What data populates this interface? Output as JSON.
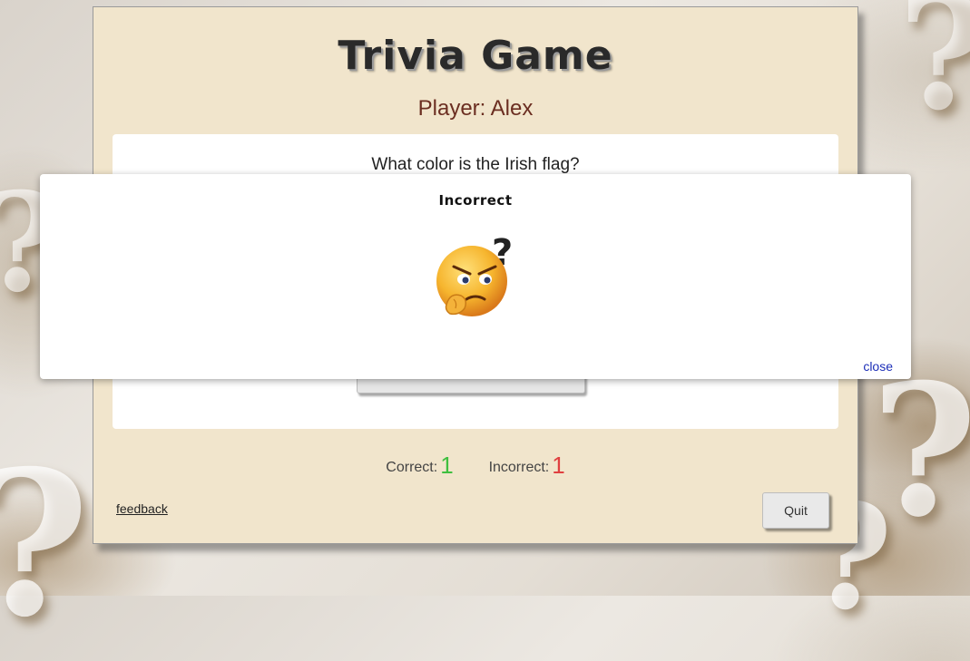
{
  "game": {
    "title": "Trivia Game",
    "player_label": "Player: Alex"
  },
  "question": {
    "text": "What color is the Irish flag?"
  },
  "score": {
    "correct_label": "Correct:",
    "correct_value": "1",
    "incorrect_label": "Incorrect:",
    "incorrect_value": "1"
  },
  "footer": {
    "feedback_label": "feedback",
    "quit_label": "Quit"
  },
  "modal": {
    "title": "Incorrect",
    "icon": "thinking-angry-face-emoji",
    "close_label": "close"
  },
  "colors": {
    "card_bg": "#f1e5cc",
    "player_text": "#6b2e21",
    "correct_value": "#3fbf3f",
    "incorrect_value": "#e04040",
    "close_link": "#1d2fb8"
  }
}
